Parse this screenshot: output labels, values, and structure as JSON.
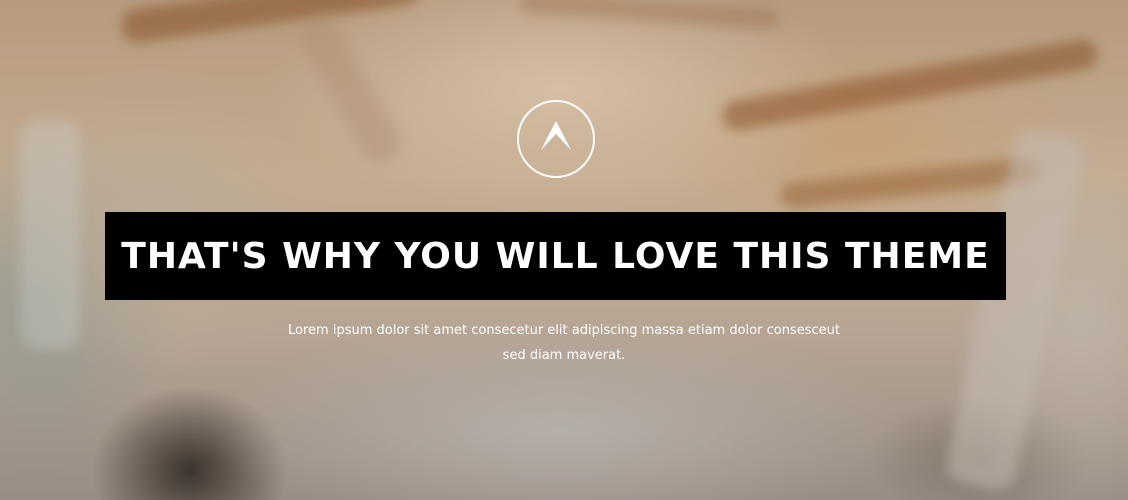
{
  "hero": {
    "logo_icon": "chevron-up-icon",
    "title": "THAT'S WHY YOU WILL LOVE THIS THEME",
    "description_line1": "Lorem ipsum dolor sit amet consecetur elit adipiscing massa etiam dolor consesceut",
    "description_line2": "sed diam maverat."
  },
  "colors": {
    "title_background": "#000000",
    "text": "#ffffff"
  }
}
